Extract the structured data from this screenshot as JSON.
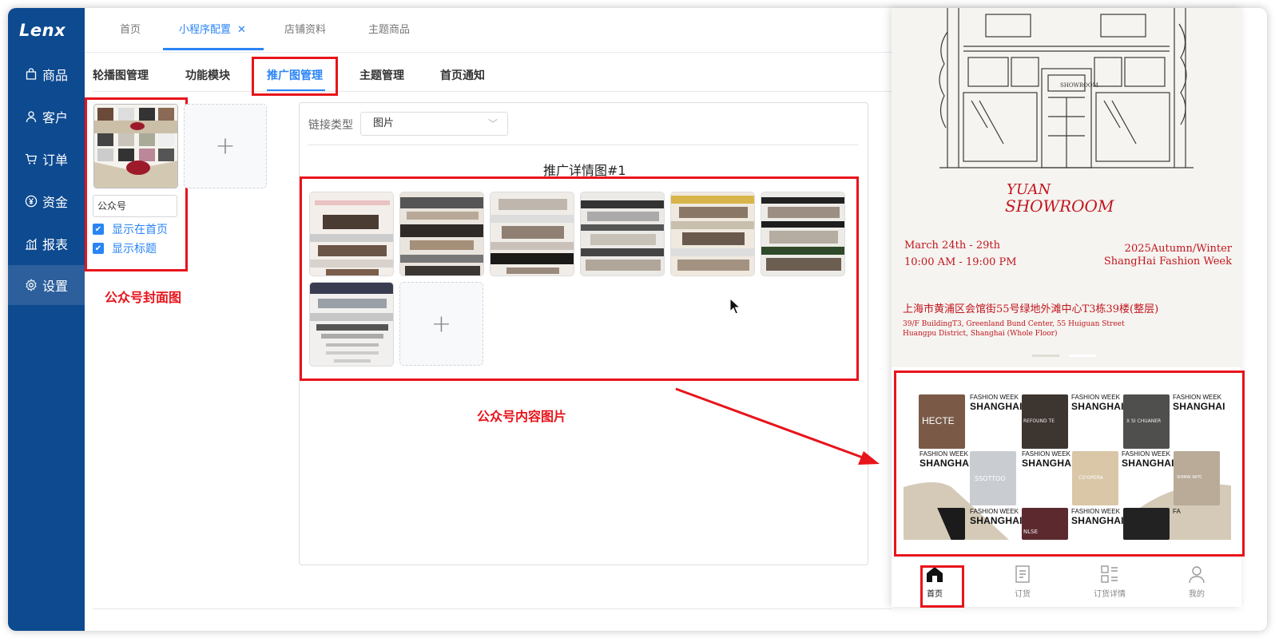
{
  "sidebar": {
    "logo": "Lenx",
    "items": [
      {
        "label": "商品",
        "icon": "bag-icon"
      },
      {
        "label": "客户",
        "icon": "user-icon"
      },
      {
        "label": "订单",
        "icon": "cart-icon"
      },
      {
        "label": "资金",
        "icon": "yen-icon"
      },
      {
        "label": "报表",
        "icon": "chart-icon"
      },
      {
        "label": "设置",
        "icon": "gear-icon",
        "active": true
      }
    ]
  },
  "top_tabs": [
    {
      "label": "首页"
    },
    {
      "label": "小程序配置",
      "active": true,
      "closable": true
    },
    {
      "label": "店铺资料"
    },
    {
      "label": "主题商品"
    }
  ],
  "sub_tabs": [
    {
      "label": "轮播图管理"
    },
    {
      "label": "功能模块"
    },
    {
      "label": "推广图管理",
      "active": true
    },
    {
      "label": "主题管理"
    },
    {
      "label": "首页通知"
    }
  ],
  "cover": {
    "name_value": "公众号",
    "show_on_home": "显示在首页",
    "show_title": "显示标题",
    "annotation": "公众号封面图"
  },
  "detail": {
    "link_type_label": "链接类型",
    "link_type_value": "图片",
    "title": "推广详情图#1",
    "annotation": "公众号内容图片"
  },
  "phone": {
    "poster": {
      "brand_line1": "YUAN",
      "brand_line2": "SHOWROOM",
      "date": "March 24th - 29th",
      "time": "10:00 AM - 19:00 PM",
      "season": "2025Autumn/Winter",
      "event": "ShangHai Fashion Week",
      "address_cn": "上海市黄浦区会馆街55号绿地外滩中心T3栋39楼(整层)",
      "address_en1": "39/F BuildingT3, Greenland Bund Center, 55 Huiguan Street",
      "address_en2": "Huangpu District, Shanghai (Whole Floor)",
      "store_sign": "SHOWROOM"
    },
    "fw_small": "FASHION WEEK",
    "fw_big": "SHANGHAI",
    "fw_partial": "FA",
    "tile_brands": [
      "HECTE",
      "REFOUND TE",
      "X SI CHUANER",
      "SSOTTOO",
      "CO'OPERA",
      "SHIMAI WITC",
      "NLSE"
    ],
    "tabbar": [
      {
        "label": "首页",
        "active": true
      },
      {
        "label": "订货"
      },
      {
        "label": "订货详情"
      },
      {
        "label": "我的"
      }
    ]
  }
}
